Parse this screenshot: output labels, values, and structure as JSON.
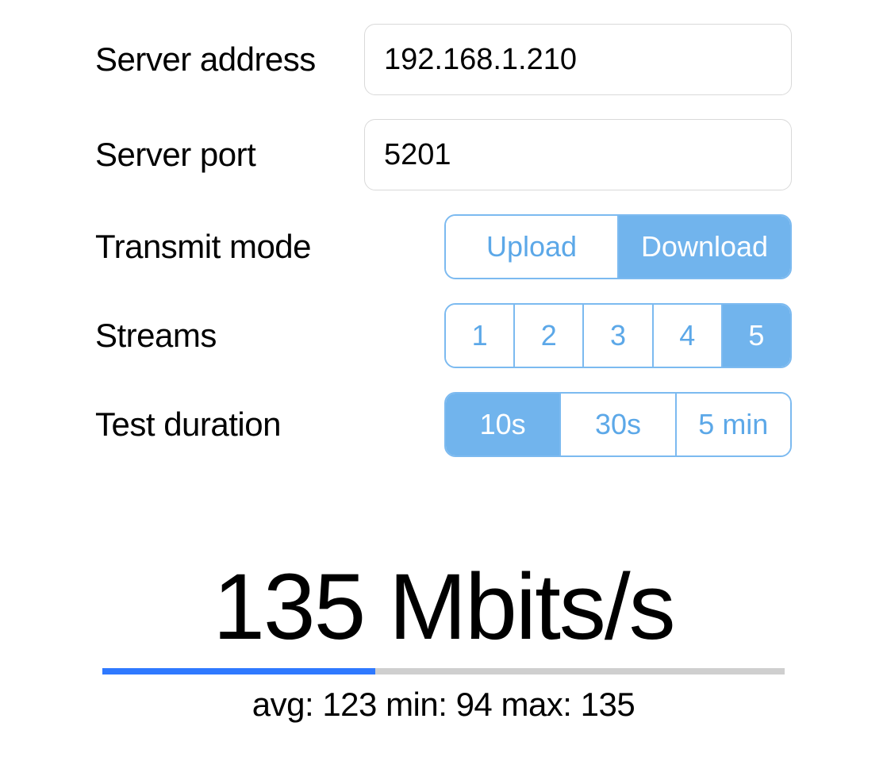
{
  "form": {
    "server_address": {
      "label": "Server address",
      "value": "192.168.1.210"
    },
    "server_port": {
      "label": "Server port",
      "value": "5201"
    },
    "transmit_mode": {
      "label": "Transmit mode",
      "options": [
        "Upload",
        "Download"
      ],
      "selected": "Download"
    },
    "streams": {
      "label": "Streams",
      "options": [
        "1",
        "2",
        "3",
        "4",
        "5"
      ],
      "selected": "5"
    },
    "test_duration": {
      "label": "Test duration",
      "options": [
        "10s",
        "30s",
        "5 min"
      ],
      "selected": "10s"
    }
  },
  "result": {
    "headline": "135 Mbits/s",
    "avg": 123,
    "min": 94,
    "max": 135,
    "stats_text": "avg: 123 min: 94 max: 135",
    "progress_percent": 40
  }
}
